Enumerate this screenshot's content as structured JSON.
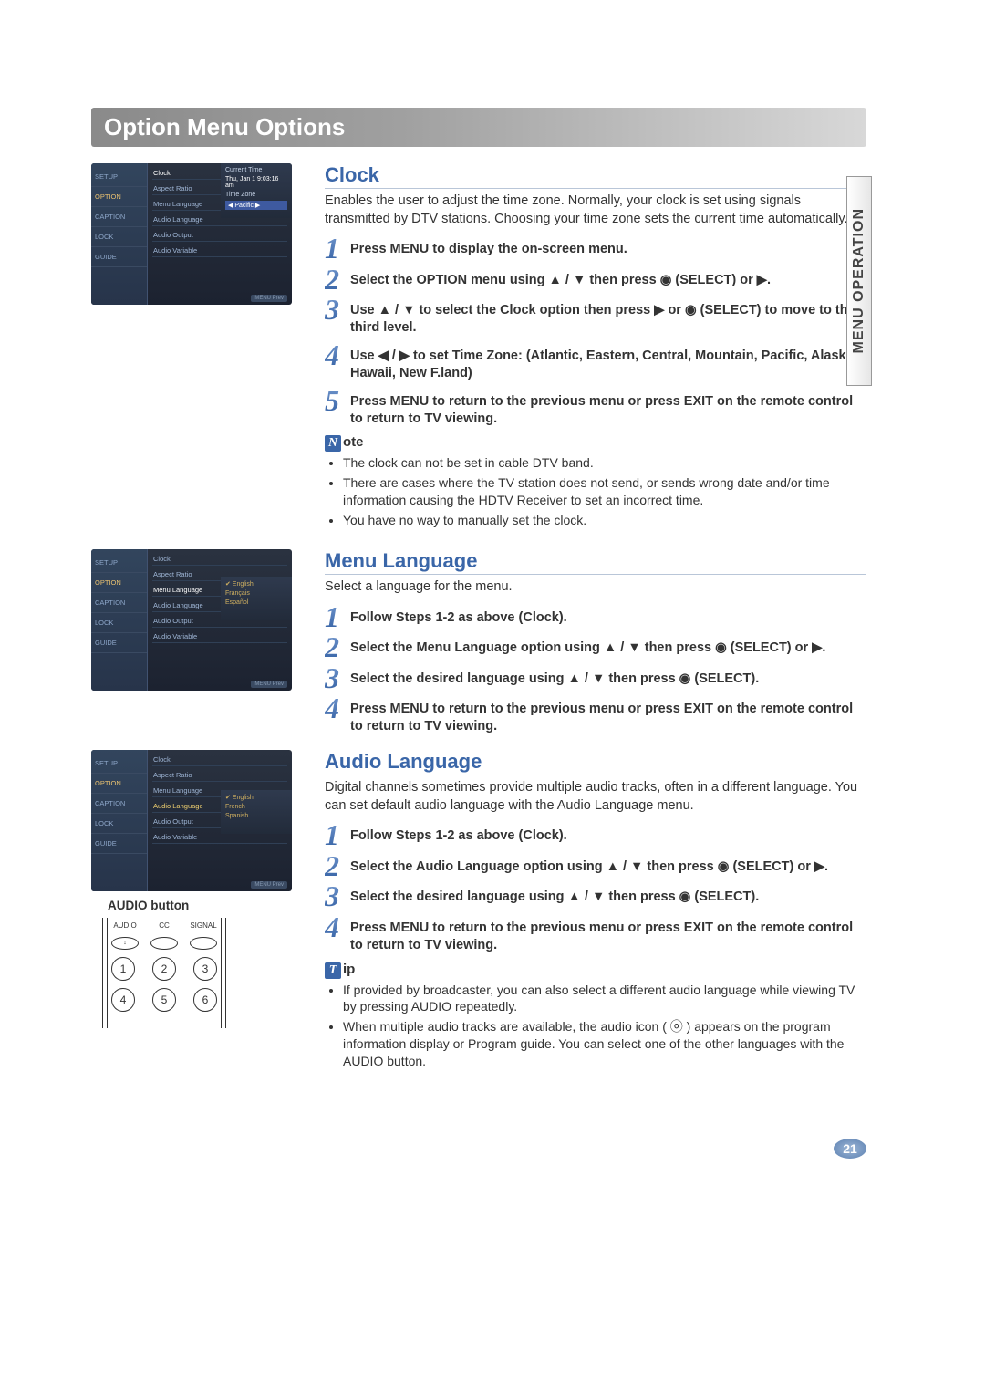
{
  "page_title": "Option Menu Options",
  "side_tab": "MENU OPERATION",
  "page_number": "21",
  "osd": {
    "tabs": [
      "SETUP",
      "OPTION",
      "CAPTION",
      "LOCK",
      "GUIDE"
    ],
    "items": [
      "Clock",
      "Aspect Ratio",
      "Menu Language",
      "Audio Language",
      "Audio Output",
      "Audio Variable"
    ],
    "clock_panel": {
      "hdr1": "Current Time",
      "val1": "Thu, Jan 1    9:03:16 am",
      "hdr2": "Time Zone",
      "val2": "◀ Pacific ▶"
    },
    "lang_panel": [
      "✔ English",
      "Français",
      "Español"
    ],
    "audio_panel": [
      "✔ English",
      "French",
      "Spanish"
    ],
    "footer": "MENU Prev"
  },
  "clock": {
    "heading": "Clock",
    "intro": "Enables the user to adjust the time zone.  Normally, your clock is set using signals transmitted by DTV stations. Choosing your time zone sets the current time automatically.",
    "steps": [
      "Press MENU to display the on-screen menu.",
      "Select the OPTION menu using ▲ / ▼ then press ◉ (SELECT) or ▶.",
      "Use ▲ / ▼ to select the Clock option then press ▶ or ◉ (SELECT) to move to the third level.",
      "Use ◀ / ▶ to set Time Zone: (Atlantic, Eastern, Central, Mountain, Pacific, Alaska, Hawaii, New F.land)",
      "Press MENU to return to the previous menu or press EXIT on the remote control to return to TV viewing."
    ],
    "note_label_icon": "N",
    "note_label_rest": "ote",
    "notes": [
      "The clock can not be set in cable DTV band.",
      "There are cases where the TV station does not send, or sends wrong date and/or time information causing the HDTV Receiver to set an incorrect time.",
      "You have no way to manually set the clock."
    ]
  },
  "menulang": {
    "heading": "Menu Language",
    "intro": "Select a language for the menu.",
    "steps": [
      "Follow Steps 1-2 as above (Clock).",
      "Select the Menu Language option using ▲ / ▼ then press ◉ (SELECT) or ▶.",
      "Select the desired language using ▲ / ▼  then press ◉ (SELECT).",
      "Press MENU to return to the previous menu or press EXIT on the remote control to return to TV viewing."
    ]
  },
  "audiolang": {
    "heading": "Audio Language",
    "intro": "Digital channels sometimes provide multiple audio tracks, often in a different language. You can set default audio language with the Audio Language menu.",
    "steps": [
      "Follow Steps 1-2 as above (Clock).",
      "Select the Audio Language option using ▲ / ▼ then press ◉ (SELECT) or ▶.",
      "Select the desired language using ▲ / ▼  then press ◉ (SELECT).",
      "Press MENU to return to the previous menu or press EXIT on the remote control to return to TV viewing."
    ],
    "tip_label_icon": "T",
    "tip_label_rest": "ip",
    "tips": [
      "If provided by broadcaster, you can also select a different audio language while viewing TV by pressing AUDIO repeatedly.",
      "When multiple audio tracks are available, the audio icon ( ⓞ ) appears on the program information display or Program guide. You can select one of the other languages with the AUDIO button."
    ]
  },
  "remote": {
    "caption": "AUDIO button",
    "top_labels": [
      "AUDIO",
      "CC",
      "SIGNAL"
    ],
    "nums_row1": [
      "1",
      "2",
      "3"
    ],
    "nums_row2": [
      "4",
      "5",
      "6"
    ]
  }
}
